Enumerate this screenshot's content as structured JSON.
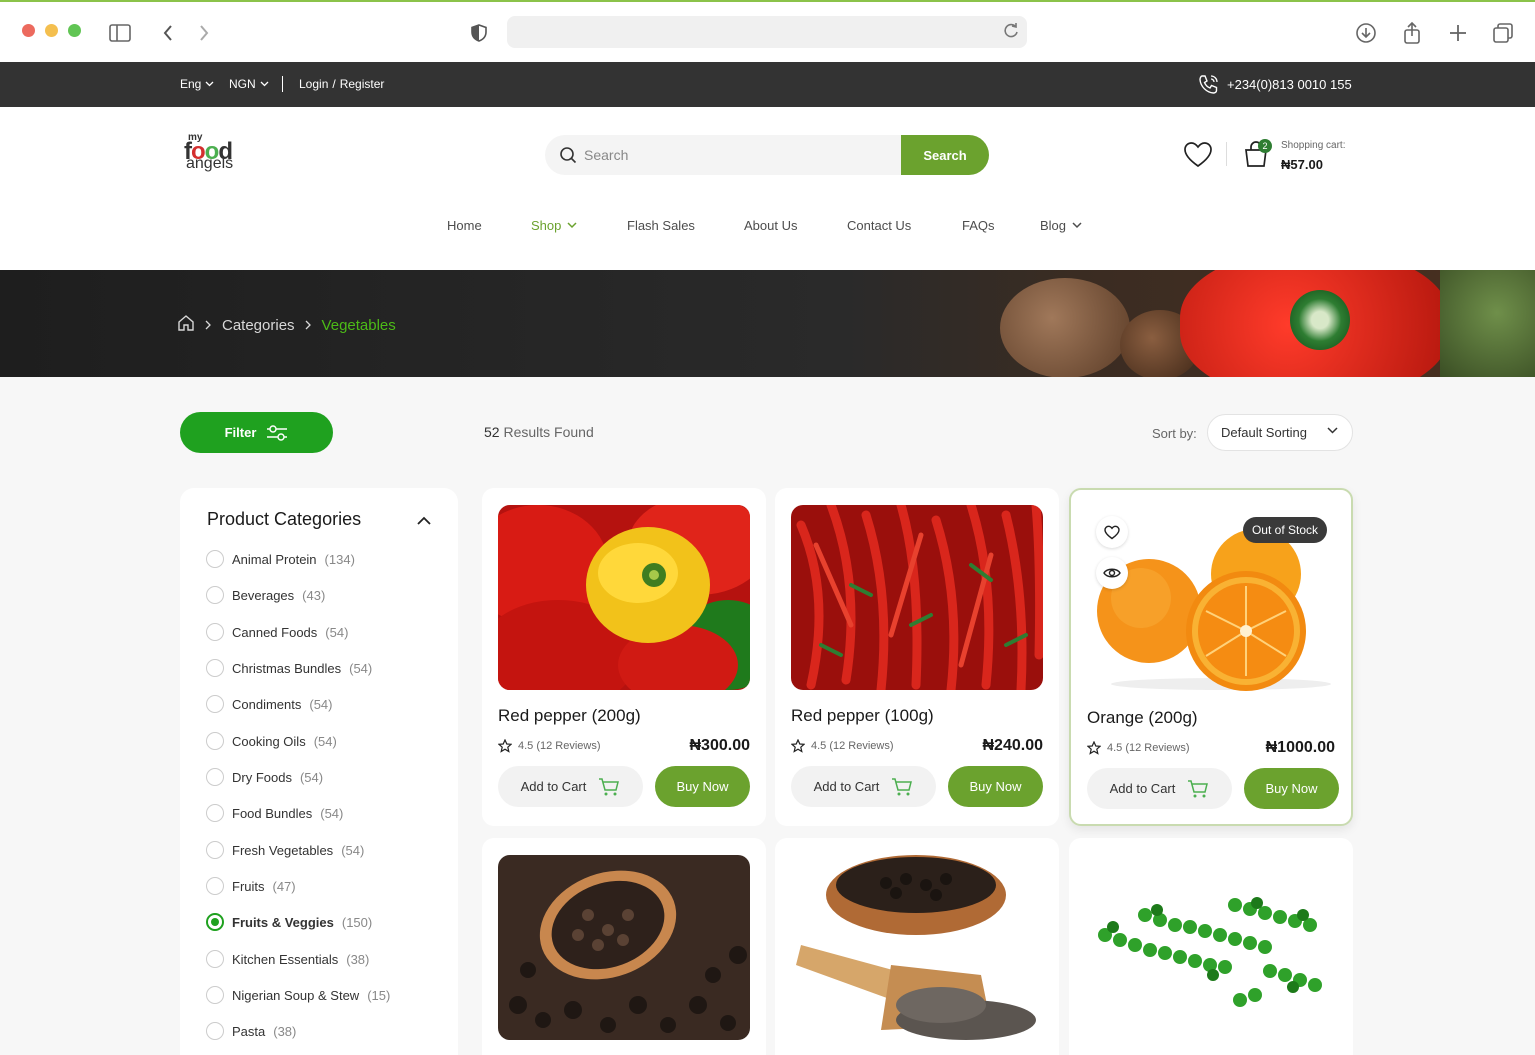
{
  "topbar": {
    "language": "Eng",
    "currency": "NGN",
    "login": "Login",
    "separator": "/",
    "register": "Register",
    "phone": "+234(0)813 0010 155"
  },
  "header": {
    "logo": {
      "my": "my",
      "food_f": "f",
      "food_o1": "o",
      "food_o2": "o",
      "food_d": "d",
      "angels": "angels"
    },
    "search_placeholder": "Search",
    "search_button": "Search",
    "cart_count": "2",
    "cart_label": "Shopping cart:",
    "cart_total": "₦57.00"
  },
  "nav": [
    {
      "label": "Home"
    },
    {
      "label": "Shop"
    },
    {
      "label": "Flash Sales"
    },
    {
      "label": "About Us"
    },
    {
      "label": "Contact Us"
    },
    {
      "label": "FAQs"
    },
    {
      "label": "Blog"
    }
  ],
  "breadcrumb": {
    "level1": "Categories",
    "current": "Vegetables"
  },
  "listing": {
    "filter_label": "Filter",
    "results_count": "52",
    "results_text": "Results Found",
    "sort_label": "Sort by:",
    "sort_value": "Default Sorting"
  },
  "sidebar": {
    "title": "Product Categories",
    "categories": [
      {
        "name": "Animal Protein",
        "count": "(134)",
        "selected": false
      },
      {
        "name": "Beverages",
        "count": "(43)",
        "selected": false
      },
      {
        "name": "Canned Foods",
        "count": "(54)",
        "selected": false
      },
      {
        "name": "Christmas Bundles",
        "count": "(54)",
        "selected": false
      },
      {
        "name": "Condiments",
        "count": "(54)",
        "selected": false
      },
      {
        "name": "Cooking Oils",
        "count": "(54)",
        "selected": false
      },
      {
        "name": "Dry Foods",
        "count": "(54)",
        "selected": false
      },
      {
        "name": "Food Bundles",
        "count": "(54)",
        "selected": false
      },
      {
        "name": "Fresh Vegetables",
        "count": "(54)",
        "selected": false
      },
      {
        "name": "Fruits",
        "count": "(47)",
        "selected": false
      },
      {
        "name": "Fruits & Veggies",
        "count": "(150)",
        "selected": true
      },
      {
        "name": "Kitchen Essentials",
        "count": "(38)",
        "selected": false
      },
      {
        "name": "Nigerian Soup & Stew",
        "count": "(15)",
        "selected": false
      },
      {
        "name": "Pasta",
        "count": "(38)",
        "selected": false
      }
    ]
  },
  "products": [
    {
      "name": "Red pepper (200g)",
      "rating": "4.5 (12 Reviews)",
      "price": "₦300.00",
      "add_to_cart": "Add to Cart",
      "buy_now": "Buy Now"
    },
    {
      "name": "Red pepper (100g)",
      "rating": "4.5 (12 Reviews)",
      "price": "₦240.00",
      "add_to_cart": "Add to Cart",
      "buy_now": "Buy Now"
    },
    {
      "name": "Orange (200g)",
      "rating": "4.5 (12 Reviews)",
      "price": "₦1000.00",
      "add_to_cart": "Add to Cart",
      "buy_now": "Buy Now",
      "badge": "Out of Stock"
    }
  ],
  "colors": {
    "brand_green": "#6ba22e",
    "filter_green": "#1fa11f",
    "breadcrumb_current": "#4cbb17",
    "topbar_bg": "#333333"
  }
}
